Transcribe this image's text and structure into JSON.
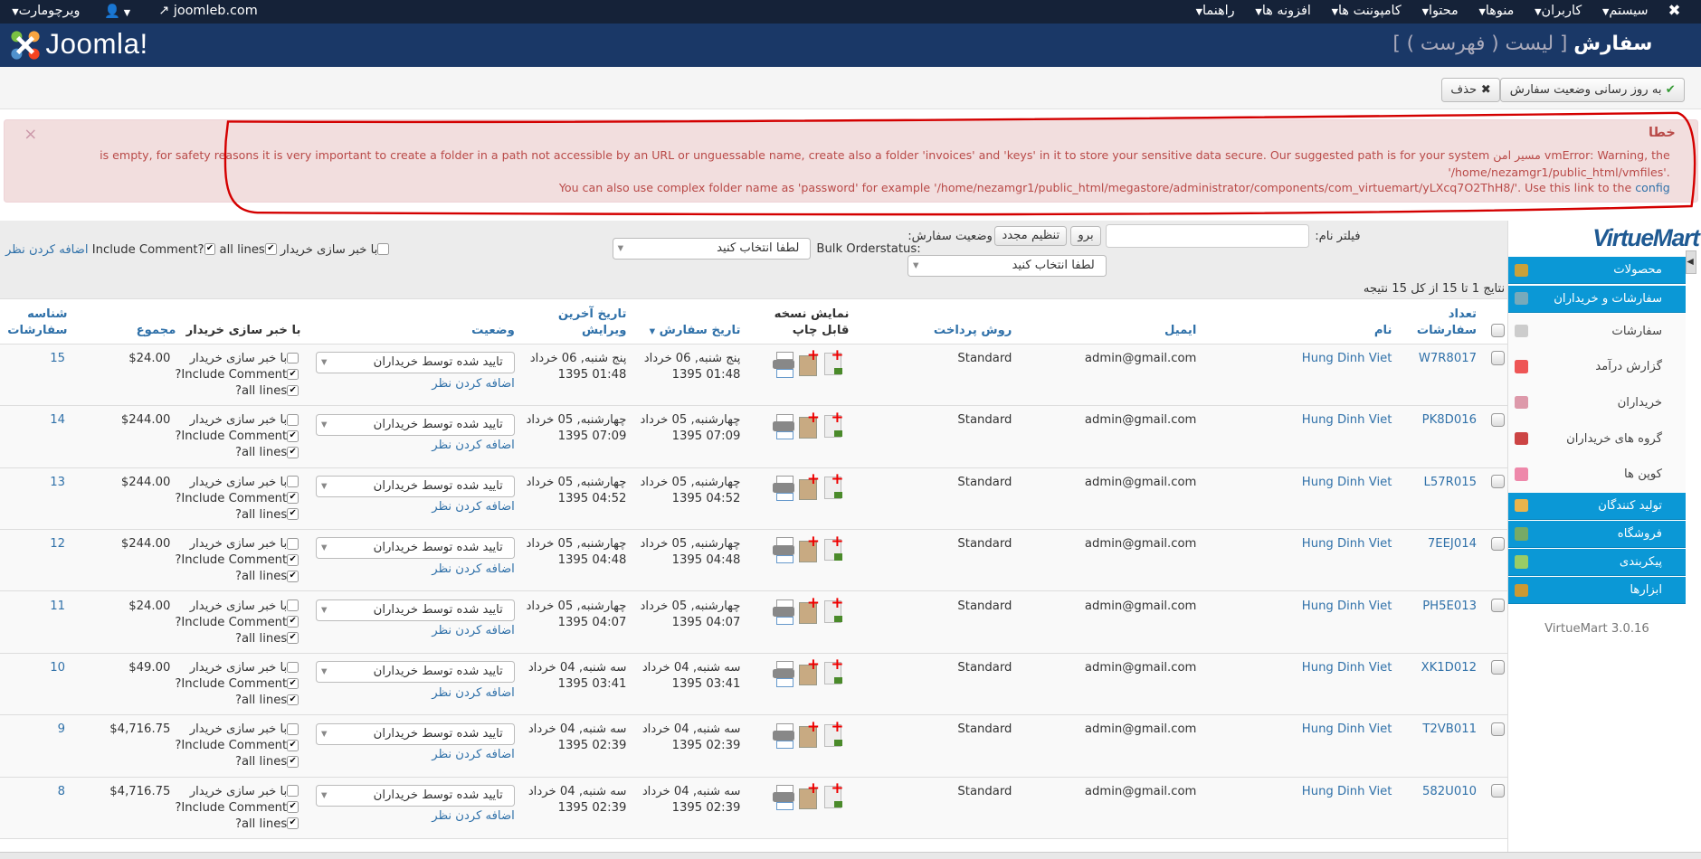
{
  "topnav": {
    "menus": [
      "سیستم",
      "کاربران",
      "منوها",
      "محتوا",
      "کامپوننت ها",
      "افزونه ها",
      "راهنما"
    ],
    "site": "joomleb.com",
    "user_menu": "",
    "component": "ویرچومارت"
  },
  "header": {
    "logo": "Joomla!",
    "title": "سفارش",
    "subtitle": "[ لیست ( فهرست ) ]"
  },
  "toolbar": {
    "update_status": "به روز رسانی وضعیت سفارش",
    "delete": "حذف"
  },
  "alert": {
    "heading": "خطا",
    "line1": "vmError: Warning, the مسیر امن is empty, for safety reasons it is very important to create a folder in a path not accessible by an URL or unguessable name, create also a folder 'invoices' and 'keys' in it to store your sensitive data secure. Our suggested path is for your system",
    "line2": "'/home/nezamgr1/public_html/vmfiles'.",
    "line3": "You can also use complex folder name as 'password' for example '/home/nezamgr1/public_html/megastore/administrator/components/com_virtuemart/yLXcq7O2ThH8/'. Use this link to the",
    "config_link": "config",
    "close": "×"
  },
  "filters": {
    "name_label": "فیلتر نام:",
    "name_value": "",
    "go": "برو",
    "reset": "تنظیم مجدد",
    "status_label": "وضعیت سفارش:",
    "status_select": "لطفا انتخاب کنید",
    "bulk_label": "Bulk Orderstatus:",
    "bulk_select": "لطفا انتخاب کنید",
    "notify": "با خبر سازی خریدار",
    "all_lines": "all lines",
    "include_comment": "Include Comment?",
    "add_comment": "اضافه کردن نظر",
    "results": "نتایج 1 تا 15 از کل 15 نتیجه"
  },
  "table": {
    "headers": {
      "order_number": [
        "تعداد",
        "سفارشات"
      ],
      "name": "نام",
      "email": "ایمیل",
      "payment": "روش پرداخت",
      "print": [
        "نمایش نسخه",
        "قابل چاپ"
      ],
      "order_date": "تاریخ سفارش",
      "modified": [
        "تاریخ آخرین",
        "ویرایش"
      ],
      "status": "وضعیت",
      "notify": "با خبر سازی خریدار",
      "total": "مجموع",
      "id": [
        "شناسه",
        "سفارشات"
      ]
    },
    "row_labels": {
      "notify": "با خبر سازی خریدار",
      "include_comment": "Include Comment?",
      "all_lines": "all lines?",
      "add_comment": "اضافه کردن نظر",
      "status": "تایید شده توسط خریداران"
    },
    "rows": [
      {
        "number": "W7R8017",
        "name": "Hung Dinh Viet",
        "email": "admin@gmail.com",
        "payment": "Standard",
        "date": "پنج شنبه, 06 خرداد",
        "time": "01:48 1395",
        "mdate": "پنج شنبه, 06 خرداد",
        "mtime": "01:48 1395",
        "total": "$24.00",
        "id": "15"
      },
      {
        "number": "PK8D016",
        "name": "Hung Dinh Viet",
        "email": "admin@gmail.com",
        "payment": "Standard",
        "date": "چهارشنبه, 05 خرداد",
        "time": "07:09 1395",
        "mdate": "چهارشنبه, 05 خرداد",
        "mtime": "07:09 1395",
        "total": "$244.00",
        "id": "14"
      },
      {
        "number": "L57R015",
        "name": "Hung Dinh Viet",
        "email": "admin@gmail.com",
        "payment": "Standard",
        "date": "چهارشنبه, 05 خرداد",
        "time": "04:52 1395",
        "mdate": "چهارشنبه, 05 خرداد",
        "mtime": "04:52 1395",
        "total": "$244.00",
        "id": "13"
      },
      {
        "number": "7EEJ014",
        "name": "Hung Dinh Viet",
        "email": "admin@gmail.com",
        "payment": "Standard",
        "date": "چهارشنبه, 05 خرداد",
        "time": "04:48 1395",
        "mdate": "چهارشنبه, 05 خرداد",
        "mtime": "04:48 1395",
        "total": "$244.00",
        "id": "12"
      },
      {
        "number": "PH5E013",
        "name": "Hung Dinh Viet",
        "email": "admin@gmail.com",
        "payment": "Standard",
        "date": "چهارشنبه, 05 خرداد",
        "time": "04:07 1395",
        "mdate": "چهارشنبه, 05 خرداد",
        "mtime": "04:07 1395",
        "total": "$24.00",
        "id": "11"
      },
      {
        "number": "XK1D012",
        "name": "Hung Dinh Viet",
        "email": "admin@gmail.com",
        "payment": "Standard",
        "date": "سه شنبه, 04 خرداد",
        "time": "03:41 1395",
        "mdate": "سه شنبه, 04 خرداد",
        "mtime": "03:41 1395",
        "total": "$49.00",
        "id": "10"
      },
      {
        "number": "T2VB011",
        "name": "Hung Dinh Viet",
        "email": "admin@gmail.com",
        "payment": "Standard",
        "date": "سه شنبه, 04 خرداد",
        "time": "02:39 1395",
        "mdate": "سه شنبه, 04 خرداد",
        "mtime": "02:39 1395",
        "total": "$4,716.75",
        "id": "9"
      },
      {
        "number": "582U010",
        "name": "Hung Dinh Viet",
        "email": "admin@gmail.com",
        "payment": "Standard",
        "date": "سه شنبه, 04 خرداد",
        "time": "02:39 1395",
        "mdate": "سه شنبه, 04 خرداد",
        "mtime": "02:39 1395",
        "total": "$4,716.75",
        "id": "8"
      }
    ]
  },
  "sidebar": {
    "logo": "VirtueMart",
    "items": [
      {
        "label": "محصولات",
        "type": "header",
        "color": "#c9a13a"
      },
      {
        "label": "سفارشات و خریداران",
        "type": "header",
        "color": "#7ab"
      },
      {
        "label": "سفارشات",
        "type": "item",
        "color": "#ccc"
      },
      {
        "label": "گزارش درآمد",
        "type": "item",
        "color": "#e55"
      },
      {
        "label": "خریداران",
        "type": "item",
        "color": "#d9a"
      },
      {
        "label": "گروه های خریداران",
        "type": "item",
        "color": "#c44"
      },
      {
        "label": "کوپن ها",
        "type": "item",
        "color": "#e8a"
      },
      {
        "label": "تولید کنندگان",
        "type": "header",
        "color": "#e9b44c"
      },
      {
        "label": "فروشگاه",
        "type": "header",
        "color": "#7a6"
      },
      {
        "label": "پیکربندی",
        "type": "header",
        "color": "#9c6"
      },
      {
        "label": "ابزارها",
        "type": "header",
        "color": "#c93"
      }
    ],
    "version": "VirtueMart 3.0.16"
  }
}
